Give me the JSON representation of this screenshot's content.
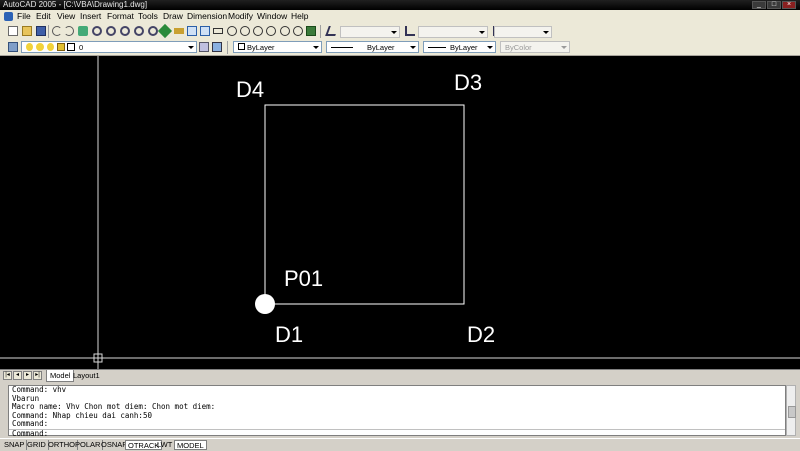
{
  "window": {
    "title": "AutoCAD 2005 - [C:\\VBA\\Drawing1.dwg]"
  },
  "menu": [
    "File",
    "Edit",
    "View",
    "Insert",
    "Format",
    "Tools",
    "Draw",
    "Dimension",
    "Modify",
    "Window",
    "Help"
  ],
  "properties": {
    "layer": "0",
    "color": "ByLayer",
    "linetype": "ByLayer",
    "lineweight": "ByLayer",
    "plotstyle": "ByColor"
  },
  "drawing": {
    "labels": [
      "D4",
      "D3",
      "P01",
      "D1",
      "D2"
    ],
    "colors": {
      "background": "#000000",
      "geometry": "#ffffff"
    }
  },
  "layout_tabs": [
    "Model",
    "Layout1"
  ],
  "command_history": [
    "Command: vhv",
    "Vbarun",
    "Macro name: Vhv Chon mot diem: Chon mot diem:",
    "Command: Nhap chieu dai canh:50",
    "Command:",
    "Command:"
  ],
  "status_toggles": [
    "SNAP",
    "GRID",
    "ORTHO",
    "POLAR",
    "OSNAP",
    "OTRACK",
    "LWT",
    "MODEL"
  ]
}
